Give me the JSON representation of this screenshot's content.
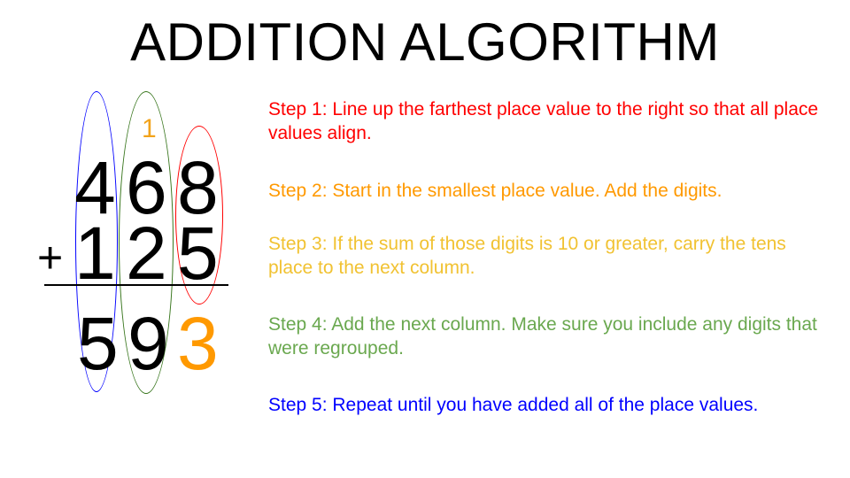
{
  "title": "ADDITION ALGORITHM",
  "problem": {
    "carry": "1",
    "top_digits": [
      "4",
      "6",
      "8"
    ],
    "operator": "+",
    "bottom_digits": [
      "1",
      "2",
      "5"
    ],
    "result_digits": [
      "5",
      "9",
      "3"
    ]
  },
  "colors": {
    "hundreds_oval": "#0000ff",
    "tens_oval": "#38761d",
    "ones_oval": "#ff0000",
    "carry": "#f2a31b",
    "result_ones": "#ff9900"
  },
  "steps": [
    {
      "text": "Step 1: Line up the farthest place value to the right so that all place values align.",
      "color": "#ff0000"
    },
    {
      "text": "Step 2: Start in the smallest place value. Add the digits.",
      "color": "#ff9900"
    },
    {
      "text": "Step 3: If the sum of those digits is 10 or greater, carry the tens place to the next column.",
      "color": "#f1c232"
    },
    {
      "text": "Step 4: Add the next column. Make sure you include any digits that were regrouped.",
      "color": "#6aa84f"
    },
    {
      "text": "Step 5: Repeat until you have added all of the place values.",
      "color": "#0000ff"
    }
  ]
}
